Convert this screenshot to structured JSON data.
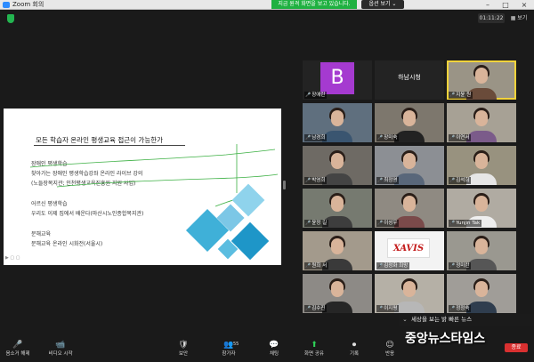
{
  "window": {
    "title": "Zoom 회의",
    "controls": {
      "min": "–",
      "max": "□",
      "close": "×"
    }
  },
  "share_banner": {
    "text": "지금 원격 화면을 보고 있습니다.",
    "view_option": "옵션 보기 ⌄"
  },
  "meeting_timer": "01:11:22",
  "view_button": "▦ 보기",
  "slide": {
    "title": "모든 학습자 온라인 평생교육 접근이 가능한가",
    "lines": [
      "장애인 평생학습",
      "찾아가는 장애인 평생학습강좌 온라인 라이브 강의",
      "(노들장복지관; 인천평생교육진흥원 지원 사업)",
      "",
      "어르신 평생학습",
      "우리도 이제 집에서 배운다(마산시노인종합복지관)",
      "",
      "문해교육",
      "문해교육 온라인 시화전(서울시)"
    ],
    "footer_mark": "▶ ▢ ▢"
  },
  "gallery": [
    {
      "name": "장애란",
      "kind": "avatar",
      "letter": "B",
      "muted": true
    },
    {
      "name": "하남시청",
      "kind": "label",
      "muted": false
    },
    {
      "name": "지윤 원",
      "kind": "video",
      "muted": true,
      "active": true
    },
    {
      "name": "남경희",
      "kind": "video",
      "muted": true
    },
    {
      "name": "장미숙",
      "kind": "video",
      "muted": true
    },
    {
      "name": "이연서",
      "kind": "video",
      "muted": true
    },
    {
      "name": "박영희",
      "kind": "video",
      "muted": true
    },
    {
      "name": "최정영",
      "kind": "video",
      "muted": true
    },
    {
      "name": "김석희",
      "kind": "video",
      "muted": true
    },
    {
      "name": "윤정 길",
      "kind": "video",
      "muted": true
    },
    {
      "name": "이성우",
      "kind": "video",
      "muted": true
    },
    {
      "name": "Yunjin Tak",
      "kind": "video",
      "muted": true
    },
    {
      "name": "원희 서",
      "kind": "video",
      "muted": true
    },
    {
      "name": "김정화 희망",
      "kind": "logo",
      "logo_text": "XAVIS",
      "muted": true
    },
    {
      "name": "정미란",
      "kind": "video",
      "muted": true
    },
    {
      "name": "김수진",
      "kind": "video",
      "muted": true
    },
    {
      "name": "이지평",
      "kind": "video",
      "muted": true
    },
    {
      "name": "정정숙",
      "kind": "video",
      "muted": true
    }
  ],
  "news_overlay": {
    "chevron": "⌄",
    "text": "세상을 보는 밝 빠른 뉴스"
  },
  "toolbar": {
    "buttons": [
      {
        "label": "음소거 해제",
        "icon": "🎤"
      },
      {
        "label": "비디오 시작",
        "icon": "📹"
      },
      {
        "label": "보안",
        "icon": "🛡"
      },
      {
        "label": "참가자",
        "icon": "👥",
        "count": "55"
      },
      {
        "label": "채팅",
        "icon": "💬"
      },
      {
        "label": "화면 공유",
        "icon": "⬆"
      },
      {
        "label": "기록",
        "icon": "⏺"
      },
      {
        "label": "반응",
        "icon": "☺"
      },
      {
        "label": "종료",
        "icon": ""
      }
    ]
  },
  "watermark": {
    "text": "중앙뉴스타임스",
    "end_label": "종료"
  },
  "colors": {
    "share_green": "#1fb141",
    "active_speaker": "#f5d33a",
    "muted_red": "#ff4040",
    "avatar_purple": "#a53ad0",
    "slide_diamond": "#3fb0d8"
  }
}
